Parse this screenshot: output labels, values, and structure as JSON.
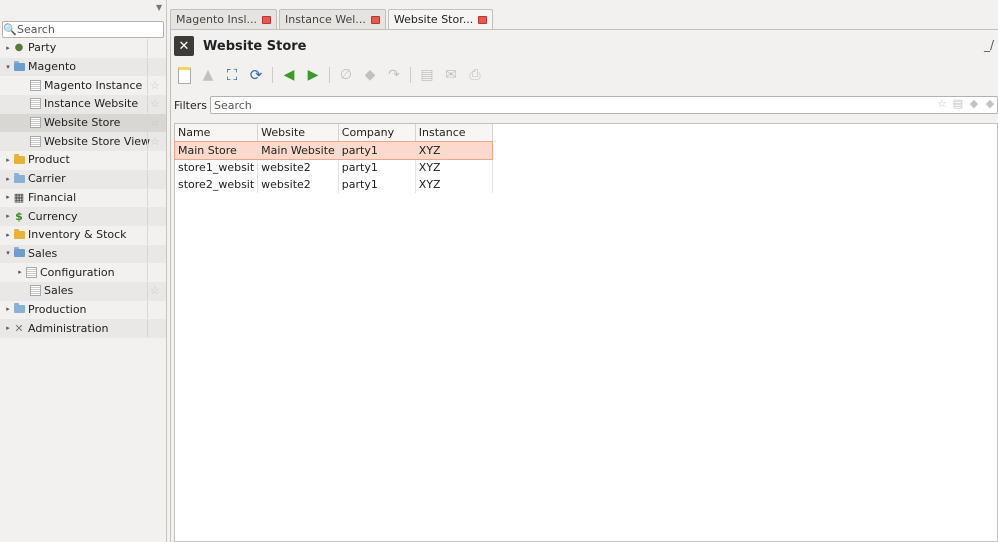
{
  "sidebar": {
    "search_placeholder": "Search",
    "items": [
      {
        "label": "Party",
        "level": 0,
        "expander": "▸",
        "icon": "party-icon"
      },
      {
        "label": "Magento",
        "level": 0,
        "expander": "▾",
        "icon": "folder-open-icon"
      },
      {
        "label": "Magento Instance",
        "level": 1,
        "expander": "",
        "icon": "document-icon"
      },
      {
        "label": "Instance Website",
        "level": 1,
        "expander": "",
        "icon": "document-icon"
      },
      {
        "label": "Website Store",
        "level": 1,
        "expander": "",
        "icon": "document-icon"
      },
      {
        "label": "Website Store View",
        "level": 1,
        "expander": "",
        "icon": "document-icon"
      },
      {
        "label": "Product",
        "level": 0,
        "expander": "▸",
        "icon": "product-icon"
      },
      {
        "label": "Carrier",
        "level": 0,
        "expander": "▸",
        "icon": "folder-icon"
      },
      {
        "label": "Financial",
        "level": 0,
        "expander": "▸",
        "icon": "financial-icon"
      },
      {
        "label": "Currency",
        "level": 0,
        "expander": "▸",
        "icon": "currency-icon"
      },
      {
        "label": "Inventory & Stock",
        "level": 0,
        "expander": "▸",
        "icon": "inventory-icon"
      },
      {
        "label": "Sales",
        "level": 0,
        "expander": "▾",
        "icon": "folder-open-icon"
      },
      {
        "label": "Configuration",
        "level": 1,
        "expander": "▸",
        "icon": "configuration-icon"
      },
      {
        "label": "Sales",
        "level": 1,
        "expander": "",
        "icon": "document-icon"
      },
      {
        "label": "Production",
        "level": 0,
        "expander": "▸",
        "icon": "folder-icon"
      },
      {
        "label": "Administration",
        "level": 0,
        "expander": "▸",
        "icon": "administration-icon"
      }
    ]
  },
  "tabs": [
    {
      "label": "Magento Insl..."
    },
    {
      "label": "Instance Wel..."
    },
    {
      "label": "Website Stor..."
    }
  ],
  "header": {
    "title": "Website Store",
    "right_text": "_/"
  },
  "toolbar": {
    "icons": [
      "new-icon",
      "save-icon",
      "switch-view-icon",
      "reload-icon",
      "previous-icon",
      "next-icon",
      "attachment-icon",
      "action-icon",
      "relate-icon",
      "report-icon",
      "email-icon",
      "print-icon"
    ]
  },
  "filters": {
    "label": "Filters",
    "placeholder": "Search"
  },
  "table": {
    "columns": [
      "Name",
      "Website",
      "Company",
      "Instance"
    ],
    "rows": [
      [
        "Main Store",
        "Main Website",
        "party1",
        "XYZ"
      ],
      [
        "store1_websit",
        "website2",
        "party1",
        "XYZ"
      ],
      [
        "store2_websit",
        "website2",
        "party1",
        "XYZ"
      ]
    ]
  },
  "colors": {
    "selection": "#fbd9cc",
    "accent_close": "#e55a4a"
  }
}
